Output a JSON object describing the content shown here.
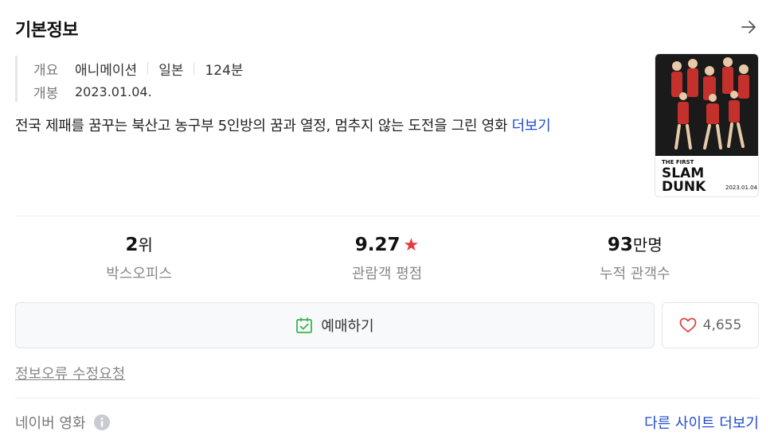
{
  "header": {
    "title": "기본정보",
    "arrow_icon": "arrow-right-icon"
  },
  "info": {
    "overview_label": "개요",
    "genre": "애니메이션",
    "country": "일본",
    "runtime": "124분",
    "release_label": "개봉",
    "release_date": "2023.01.04."
  },
  "synopsis": {
    "text": "전국 제패를 꿈꾸는 북산고 농구부 5인방의 꿈과 열정, 멈추지 않는 도전을 그린 영화 ",
    "more_label": "더보기"
  },
  "poster": {
    "title_line1": "THE FIRST",
    "title_line2": "SLAM",
    "title_line3": "DUNK",
    "date": "2023.01.04"
  },
  "stats": {
    "rank_value": "2",
    "rank_unit": "위",
    "rank_label": "박스오피스",
    "rating_value": "9.27",
    "rating_star": "★",
    "rating_label": "관람객 평점",
    "audience_value": "93",
    "audience_unit": "만명",
    "audience_label": "누적 관객수"
  },
  "actions": {
    "reserve_label": "예매하기",
    "reserve_icon": "calendar-check-icon",
    "like_icon": "heart-icon",
    "like_count": "4,655"
  },
  "report_label": "정보오류 수정요청",
  "footer": {
    "source_label": "네이버 영화",
    "info_icon": "info-icon",
    "other_sites_label": "다른 사이트 더보기"
  },
  "colors": {
    "link": "#1f4bd1",
    "star": "#e8373f",
    "calendar": "#3cb54a",
    "heart": "#e8373f"
  }
}
